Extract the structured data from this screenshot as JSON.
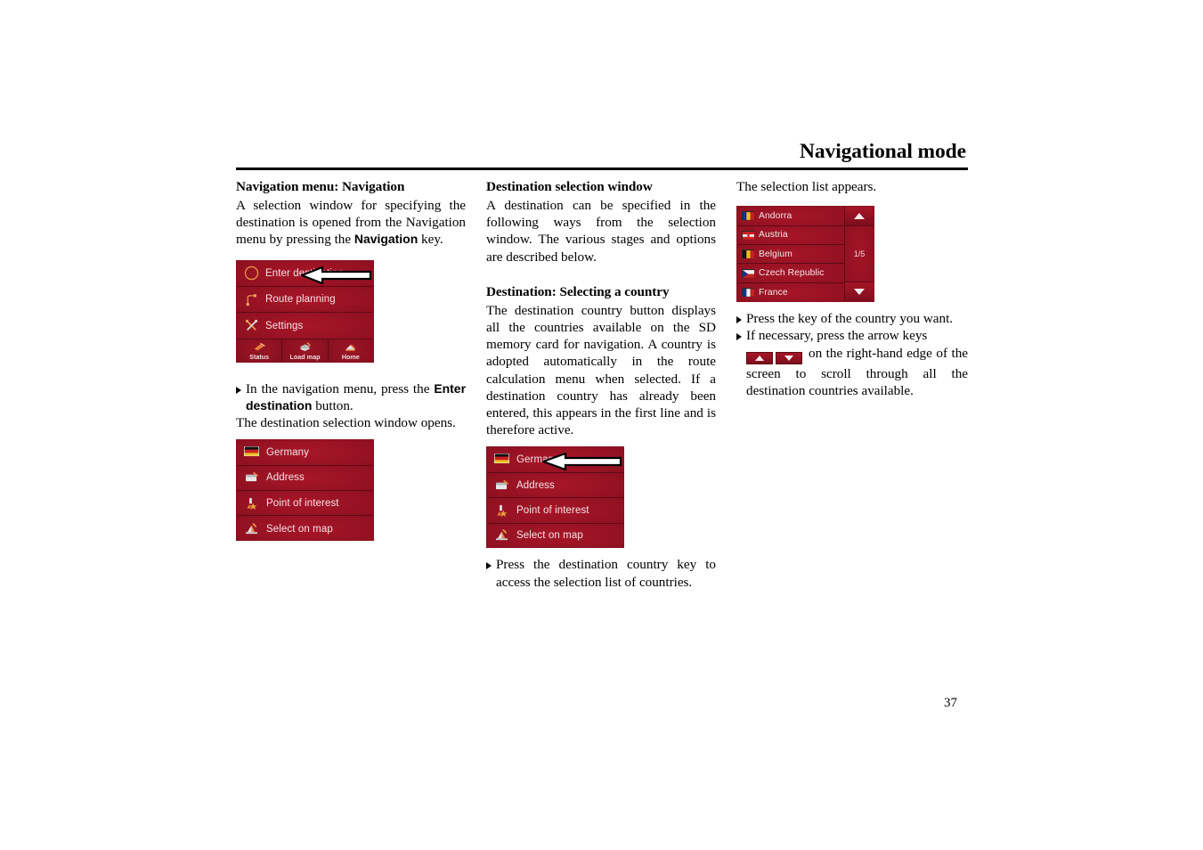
{
  "header": {
    "title": "Navigational mode"
  },
  "page_number": "37",
  "colors": {
    "device_red_light": "#a81628",
    "device_red_mid": "#8c1020",
    "device_red_dark": "#6e0b18",
    "device_border": "#8a1020",
    "device_text": "#f2e3e6",
    "page_background": "#ffffff",
    "text": "#000000"
  },
  "left_column": {
    "heading": "Navigation menu: Navigation",
    "intro_part1": "A selection window for specifying the destination is opened from the Navigation menu by pressing the ",
    "intro_bold": "Navigation",
    "intro_part2": " key.",
    "nav_menu_screenshot": {
      "name": "navigation-menu",
      "rows": [
        {
          "icon": "compass-icon",
          "label": "Enter destination"
        },
        {
          "icon": "route-icon",
          "label": "Route planning"
        },
        {
          "icon": "tools-icon",
          "label": "Settings"
        }
      ],
      "toolbar": [
        {
          "icon": "status-icon",
          "label": "Status"
        },
        {
          "icon": "load-map-icon",
          "label": "Load map"
        },
        {
          "icon": "home-icon",
          "label": "Home"
        }
      ],
      "callout": "arrow-pointing-to-enter-destination"
    },
    "bullet_part1": "In the navigation menu, press the ",
    "bullet_bold": "Enter destination",
    "bullet_part2": " button.",
    "after_bullet": "The destination selection window opens.",
    "dest_screenshot": {
      "name": "destination-selection-window",
      "rows": [
        {
          "icon": "germany-flag-icon",
          "label": "Germany"
        },
        {
          "icon": "address-icon",
          "label": "Address"
        },
        {
          "icon": "point-of-interest-icon",
          "label": "Point of interest"
        },
        {
          "icon": "select-on-map-icon",
          "label": "Select on map"
        }
      ]
    }
  },
  "middle_column": {
    "heading_1": "Destination selection window",
    "para_1": "A destination can be specified in the following ways from the selection window. The various stages and options are described below.",
    "heading_2": "Destination: Selecting a country",
    "para_2": "The destination country button displays all the countries available on the SD memory card for navigation. A country is adopted automatically in the route calculation menu when selected. If a destination country has already been entered, this appears in the first line and is therefore active.",
    "dest_screenshot": {
      "name": "destination-selection-window-with-callout",
      "rows": [
        {
          "icon": "germany-flag-icon",
          "label": "Germany"
        },
        {
          "icon": "address-icon",
          "label": "Address"
        },
        {
          "icon": "point-of-interest-icon",
          "label": "Point of interest"
        },
        {
          "icon": "select-on-map-icon",
          "label": "Select on map"
        }
      ],
      "callout": "arrow-pointing-to-germany"
    },
    "bullet_1": "Press the destination country key to access the selection list of countries."
  },
  "right_column": {
    "intro": "The selection list appears.",
    "country_list_screenshot": {
      "name": "country-selection-list",
      "page_indicator": "1/5",
      "scroll_up": "scroll-up-arrow",
      "scroll_down": "scroll-down-arrow",
      "countries": [
        {
          "flag": "andorra-flag-icon",
          "label": "Andorra"
        },
        {
          "flag": "austria-flag-icon",
          "label": "Austria"
        },
        {
          "flag": "belgium-flag-icon",
          "label": "Belgium"
        },
        {
          "flag": "czech-republic-flag-icon",
          "label": "Czech Republic"
        },
        {
          "flag": "france-flag-icon",
          "label": "France"
        }
      ]
    },
    "bullet_1": "Press the key of the country you want.",
    "bullet_2_part1": "If necessary, press the arrow keys",
    "bullet_2_part2": "on the right-hand edge of the screen to scroll through all the destination countries available."
  }
}
